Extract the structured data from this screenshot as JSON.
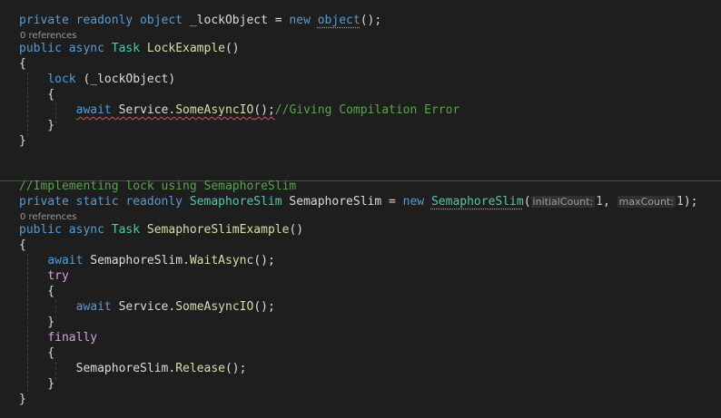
{
  "editor": {
    "lines": [
      [
        [
          "kw",
          "private readonly object "
        ],
        [
          "plain",
          "_lockObject = "
        ],
        [
          "kw",
          "new "
        ],
        [
          "kw",
          "object",
          "dots"
        ],
        [
          "plain",
          "();"
        ]
      ],
      [
        [
          "plain",
          "ref0"
        ]
      ],
      [
        [
          "kw",
          "public async "
        ],
        [
          "type",
          "Task "
        ],
        [
          "method",
          "LockExample"
        ],
        [
          "plain",
          "()"
        ]
      ],
      [
        [
          "plain",
          "{"
        ]
      ],
      [
        [
          "plain",
          "    "
        ],
        [
          "kw",
          "lock "
        ],
        [
          "plain",
          "(_lockObject)"
        ]
      ],
      [
        [
          "plain",
          "    {"
        ]
      ],
      [
        [
          "plain",
          "        "
        ],
        [
          "kw",
          "await ",
          "squiggle"
        ],
        [
          "plain",
          "Service.",
          "squiggle"
        ],
        [
          "method",
          "SomeAsyncIO",
          "squiggle"
        ],
        [
          "plain",
          "();",
          "squiggle"
        ],
        [
          "comment",
          "//Giving Compilation Error"
        ]
      ],
      [
        [
          "plain",
          "    }"
        ]
      ],
      [
        [
          "plain",
          "}"
        ]
      ],
      [],
      [],
      [
        [
          "comment",
          "//Implementing lock using SemaphoreSlim"
        ]
      ],
      [
        [
          "kw",
          "private static readonly "
        ],
        [
          "type",
          "SemaphoreSlim "
        ],
        [
          "plain",
          "SemaphoreSlim = "
        ],
        [
          "kw",
          "new "
        ],
        [
          "type",
          "SemaphoreSlim",
          "dots"
        ],
        [
          "plain",
          "("
        ],
        [
          "hint",
          "initialCount:"
        ],
        [
          "num",
          "1"
        ],
        [
          "plain",
          ", "
        ],
        [
          "hint",
          "maxCount:"
        ],
        [
          "num",
          "1"
        ],
        [
          "plain",
          ");"
        ]
      ],
      [
        [
          "plain",
          "ref1"
        ]
      ],
      [
        [
          "kw",
          "public async "
        ],
        [
          "type",
          "Task "
        ],
        [
          "method",
          "SemaphoreSlimExample"
        ],
        [
          "plain",
          "()"
        ]
      ],
      [
        [
          "plain",
          "{"
        ]
      ],
      [
        [
          "plain",
          "    "
        ],
        [
          "kw",
          "await "
        ],
        [
          "plain",
          "SemaphoreSlim."
        ],
        [
          "method",
          "WaitAsync"
        ],
        [
          "plain",
          "();"
        ]
      ],
      [
        [
          "plain",
          "    "
        ],
        [
          "ctl",
          "try"
        ]
      ],
      [
        [
          "plain",
          "    {"
        ]
      ],
      [
        [
          "plain",
          "        "
        ],
        [
          "kw",
          "await "
        ],
        [
          "plain",
          "Service."
        ],
        [
          "method",
          "SomeAsyncIO"
        ],
        [
          "plain",
          "();"
        ]
      ],
      [
        [
          "plain",
          "    }"
        ]
      ],
      [
        [
          "plain",
          "    "
        ],
        [
          "ctl",
          "finally"
        ]
      ],
      [
        [
          "plain",
          "    {"
        ]
      ],
      [
        [
          "plain",
          "        SemaphoreSlim."
        ],
        [
          "method",
          "Release"
        ],
        [
          "plain",
          "();"
        ]
      ],
      [
        [
          "plain",
          "    }"
        ]
      ],
      [
        [
          "plain",
          "}"
        ]
      ]
    ],
    "references": [
      "0 references",
      "0 references"
    ]
  },
  "colors": {
    "background": "#1e1e1e",
    "keyword": "#569cd6",
    "control_keyword": "#d8a0df",
    "type": "#4ec9b0",
    "method": "#dcdcaa",
    "comment": "#57a64a",
    "plain": "#dcdcdc",
    "number": "#b5cea8",
    "error_squiggle": "#f14c4c"
  }
}
